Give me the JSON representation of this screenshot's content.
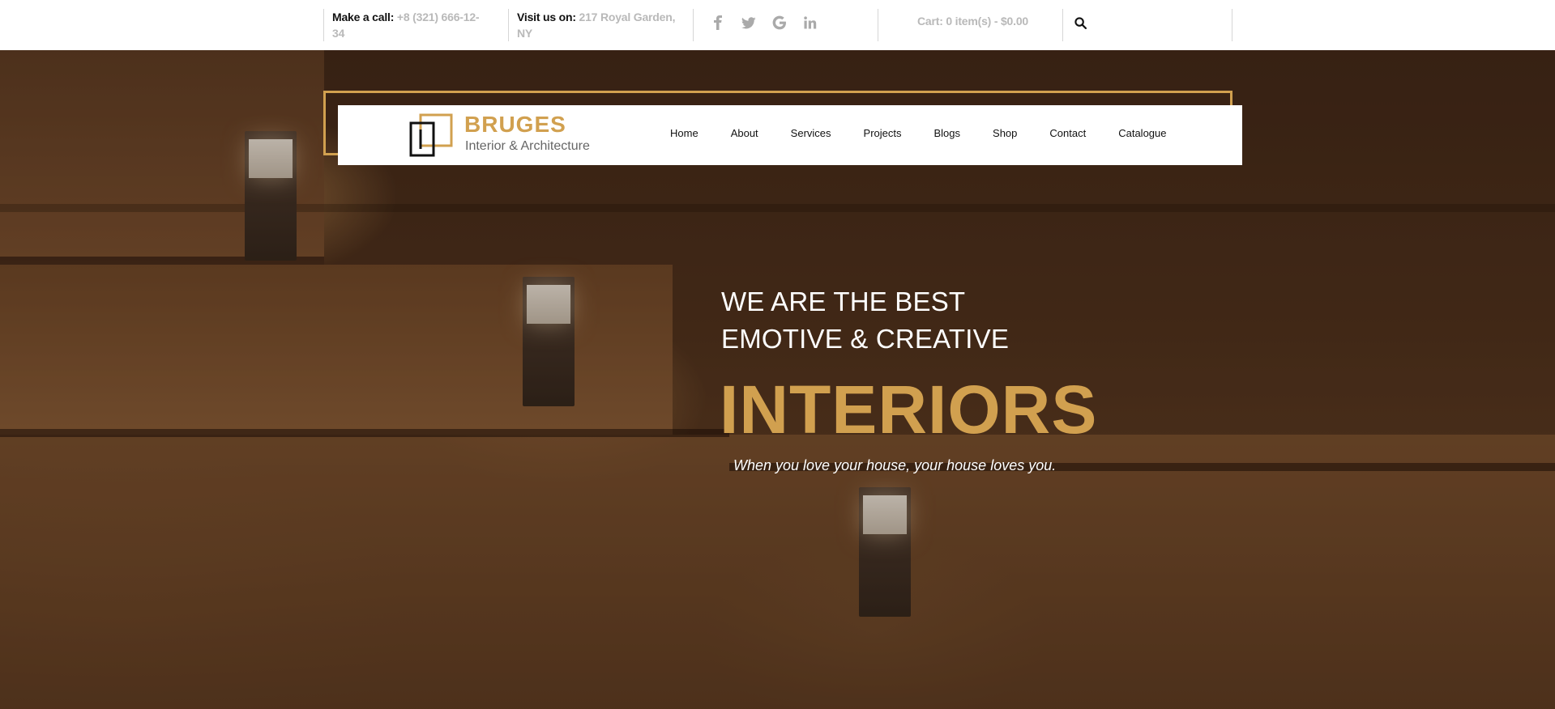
{
  "topbar": {
    "call_label": "Make a call:",
    "call_value": "+8 (321) 666-12-34",
    "visit_label": "Visit us on:",
    "visit_value": "217 Royal Garden, NY",
    "socials": [
      "facebook-icon",
      "twitter-icon",
      "google-icon",
      "linkedin-icon"
    ],
    "cart": "Cart: 0 item(s) - $0.00",
    "search_icon": "search-icon"
  },
  "brand": {
    "name": "BRUGES",
    "tagline": "Interior & Architecture"
  },
  "nav": {
    "items": [
      "Home",
      "About",
      "Services",
      "Projects",
      "Blogs",
      "Shop",
      "Contact",
      "Catalogue"
    ]
  },
  "hero": {
    "line1": "WE ARE THE BEST",
    "line2": "EMOTIVE & CREATIVE",
    "title": "INTERIORS",
    "subtitle": "When you love your house, your house loves you."
  },
  "colors": {
    "accent": "#d1a04f",
    "muted_text": "#b9b9b9",
    "dark_text": "#111111"
  }
}
